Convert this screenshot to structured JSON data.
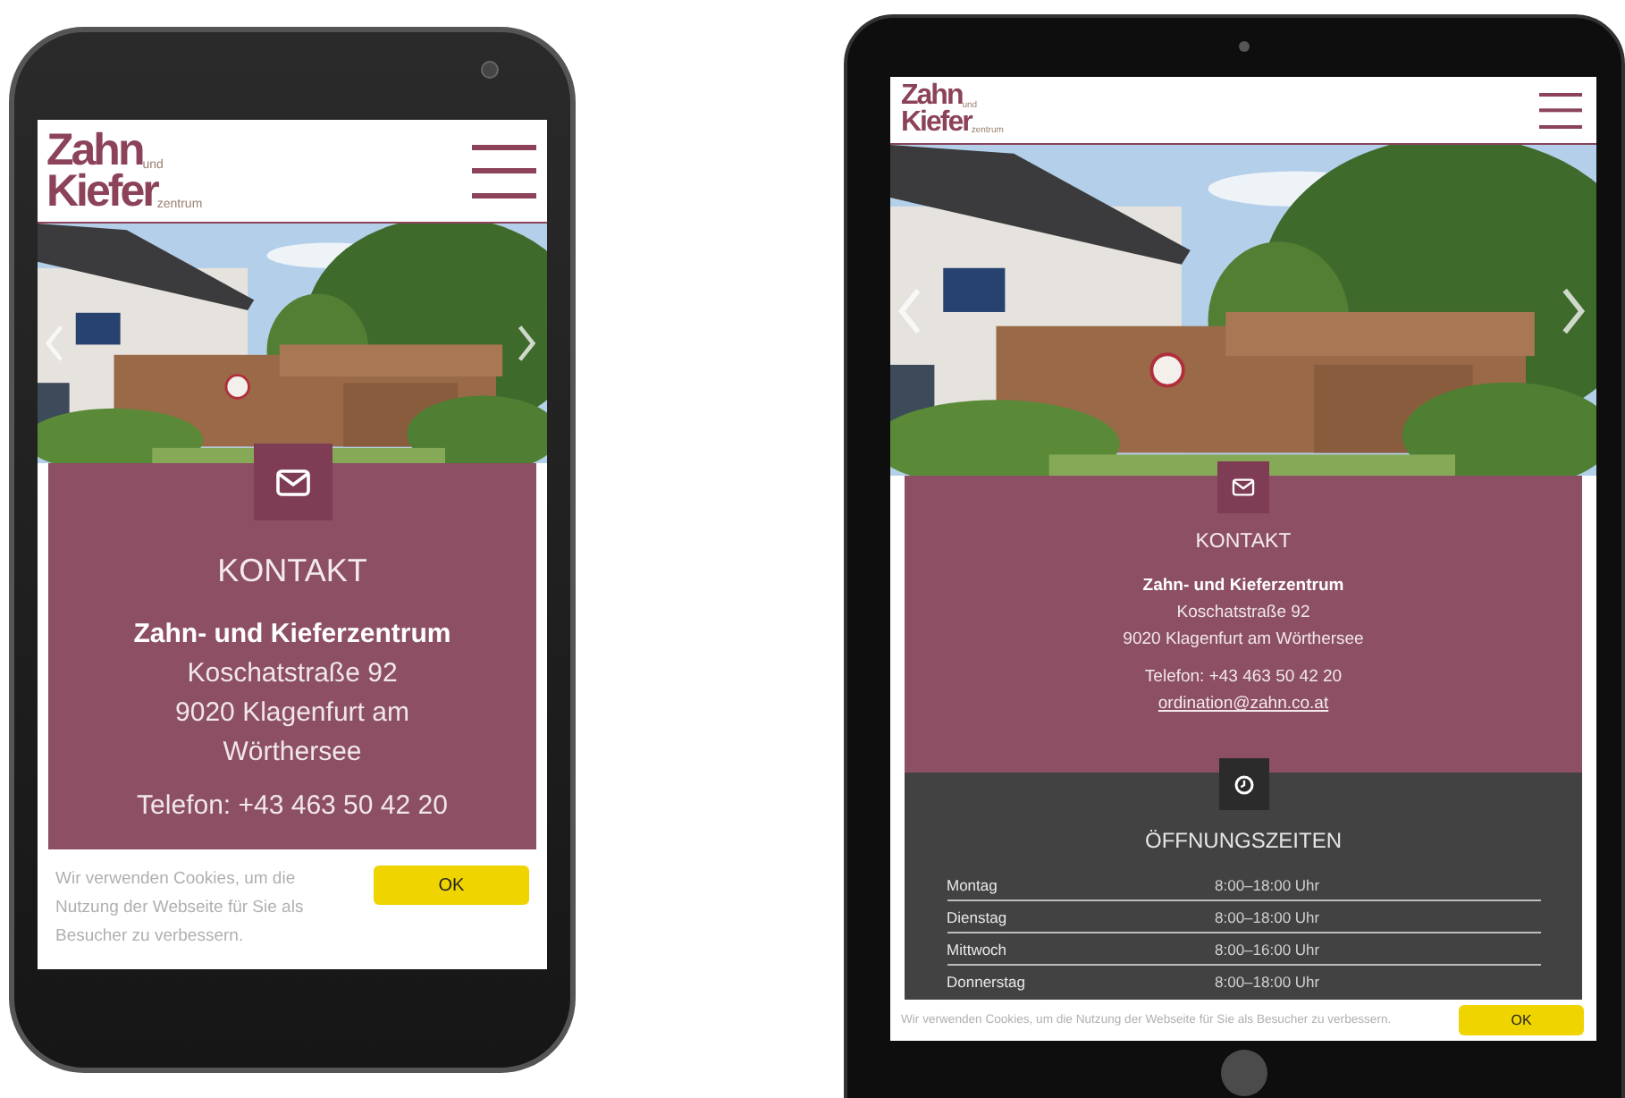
{
  "devices": [
    {
      "kind": "phone",
      "logo": {
        "top": "Zahn",
        "top_small": "und",
        "bottom": "Kiefer",
        "bottom_small": "zentrum"
      },
      "contact": {
        "title": "KONTAKT",
        "name": "Zahn- und Kieferzentrum",
        "address": [
          "Koschatstraße 92",
          "9020 Klagenfurt am Wörthersee"
        ],
        "phone": "Telefon: +43 463 50 42 20"
      },
      "cookie": {
        "text": "Wir verwenden Cookies, um die Nutzung der Webseite für Sie als Besucher zu verbessern.",
        "button": "OK"
      }
    },
    {
      "kind": "tablet",
      "logo": {
        "top": "Zahn",
        "top_small": "und",
        "bottom": "Kiefer",
        "bottom_small": "zentrum"
      },
      "contact": {
        "title": "KONTAKT",
        "name": "Zahn- und Kieferzentrum",
        "address": [
          "Koschatstraße 92",
          "9020 Klagenfurt am Wörthersee"
        ],
        "phone": "Telefon: +43 463 50 42 20",
        "email": "ordination@zahn.co.at"
      },
      "hours": {
        "title": "ÖFFNUNGSZEITEN",
        "rows": [
          {
            "day": "Montag",
            "time": "8:00–18:00 Uhr"
          },
          {
            "day": "Dienstag",
            "time": "8:00–18:00 Uhr"
          },
          {
            "day": "Mittwoch",
            "time": "8:00–16:00 Uhr"
          },
          {
            "day": "Donnerstag",
            "time": "8:00–18:00 Uhr"
          }
        ]
      },
      "cookie": {
        "text": "Wir verwenden Cookies, um die Nutzung der Webseite für Sie als Besucher zu verbessern.",
        "button": "OK"
      }
    }
  ]
}
